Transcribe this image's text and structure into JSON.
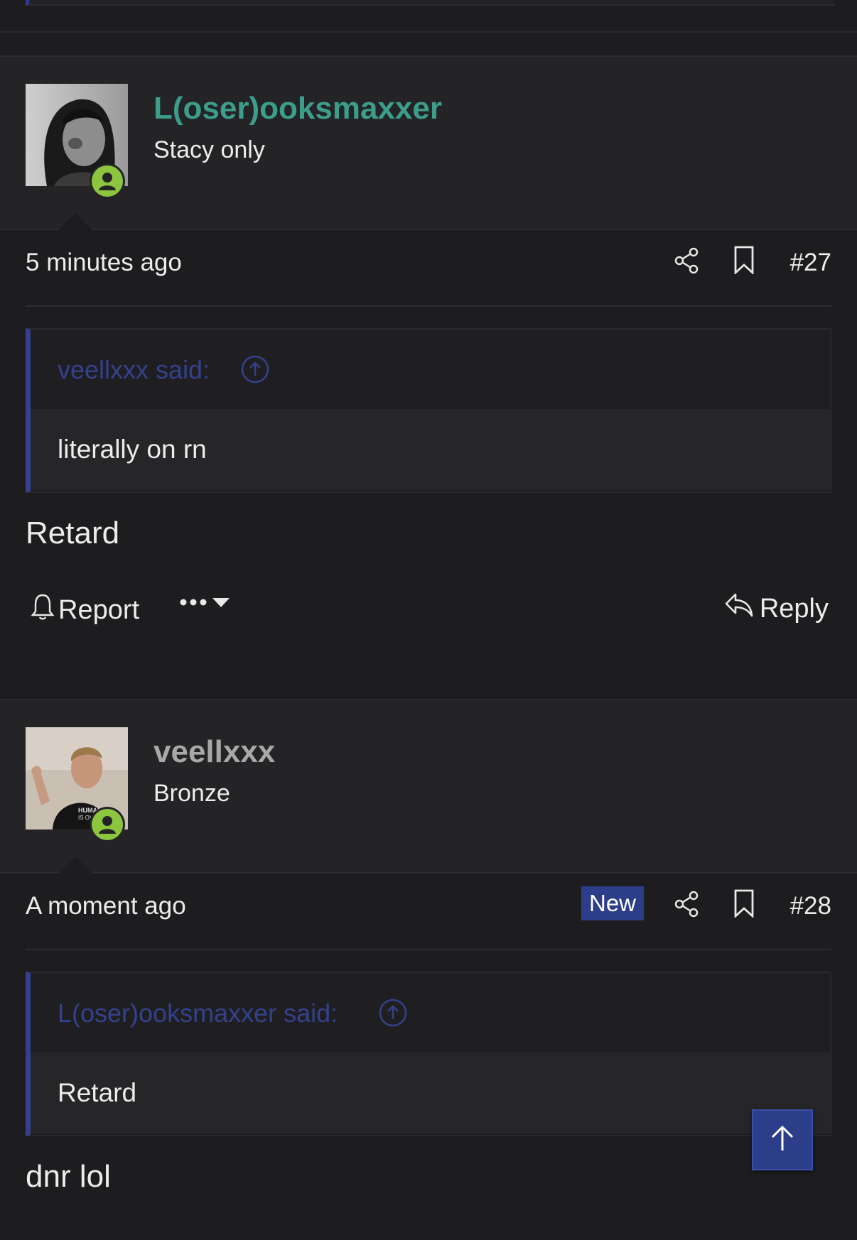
{
  "colors": {
    "page_bg": "#1d1d1f",
    "header_bg": "#242426",
    "accent_blue": "#2c3d8a",
    "quote_bar": "#34418d",
    "online_green": "#8cc63f",
    "username_teal": "#3c9e8a",
    "username_gray": "#a8a8a8"
  },
  "posts": [
    {
      "username": "L(oser)ooksmaxxer",
      "username_color": "#3c9e8a",
      "user_title": "Stacy only",
      "avatar_icon": "avatar-woman-photo",
      "online": true,
      "time": "5 minutes ago",
      "is_new": false,
      "post_number": "#27",
      "quote": {
        "author": "veellxxx said:",
        "text": "literally on rn"
      },
      "body": "Retard",
      "actions": {
        "report": "Report",
        "reply": "Reply"
      }
    },
    {
      "username": "veellxxx",
      "username_color": "#a8a8a8",
      "user_title": "Bronze",
      "avatar_icon": "avatar-man-waving-photo",
      "online": true,
      "time": "A moment ago",
      "is_new": true,
      "new_label": "New",
      "post_number": "#28",
      "quote": {
        "author": "L(oser)ooksmaxxer said:",
        "text": "Retard"
      },
      "body": "dnr lol"
    }
  ],
  "scroll_top_icon": "arrow-up-icon"
}
